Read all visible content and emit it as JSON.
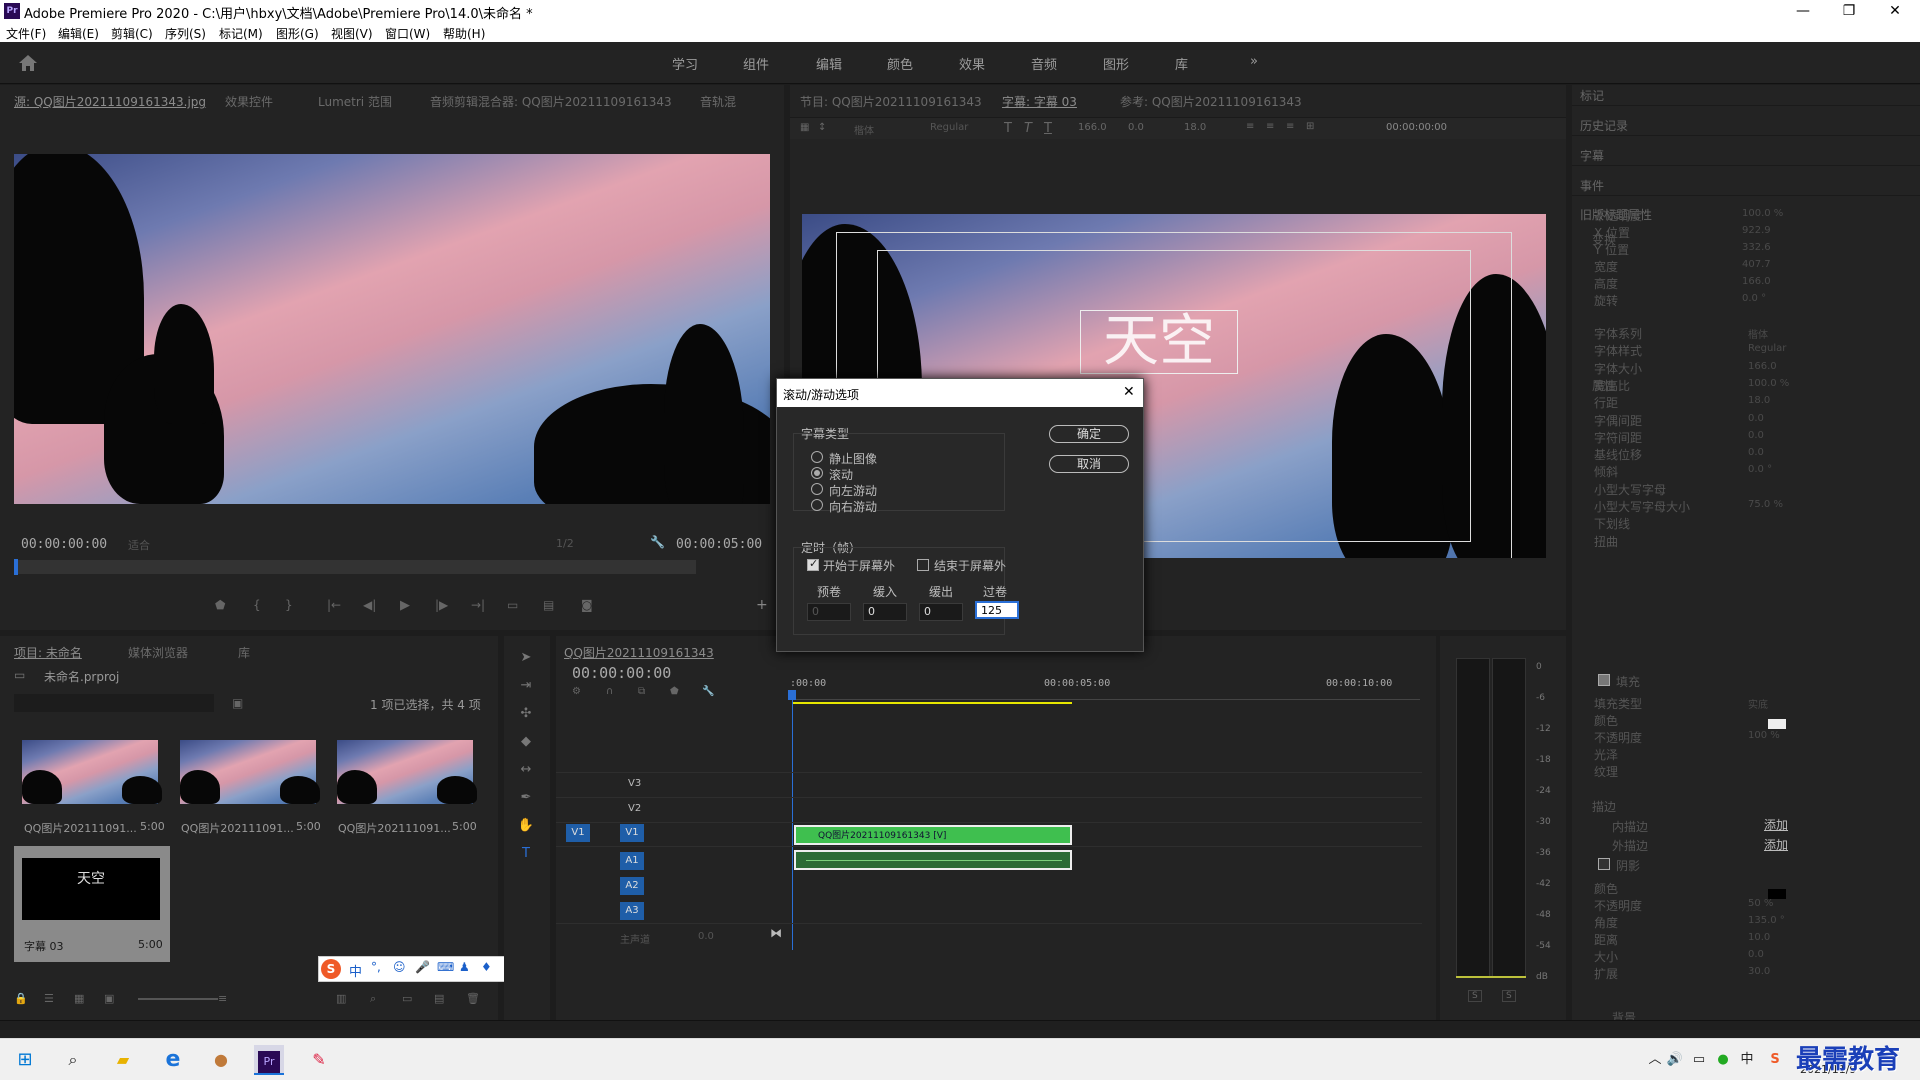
{
  "titlebar": {
    "icon": "Pr",
    "title": "Adobe Premiere Pro 2020 - C:\\用户\\hbxy\\文档\\Adobe\\Premiere Pro\\14.0\\未命名 *",
    "min": "—",
    "max": "❐",
    "close": "✕"
  },
  "menu": [
    "文件(F)",
    "编辑(E)",
    "剪辑(C)",
    "序列(S)",
    "标记(M)",
    "图形(G)",
    "视图(V)",
    "窗口(W)",
    "帮助(H)"
  ],
  "workspaces": [
    "学习",
    "组件",
    "编辑",
    "颜色",
    "效果",
    "音频",
    "图形",
    "库"
  ],
  "workspace_more": "»",
  "source_panel": {
    "tabs": [
      "源: QQ图片20211109161343.jpg",
      "效果控件",
      "Lumetri 范围",
      "音频剪辑混合器: QQ图片20211109161343",
      "音轨混"
    ],
    "timecode_left": "00:00:00:00",
    "fit": "适合",
    "half": "1/2",
    "timecode_right": "00:00:05:00"
  },
  "program_panel": {
    "tabs": [
      "节目: QQ图片20211109161343",
      "字幕: 字幕 03",
      "参考: QQ图片20211109161343"
    ],
    "font_family": "楷体",
    "font_style": "Regular",
    "size": "166.0",
    "kern": "0.0",
    "lead": "18.0",
    "timecode": "00:00:00:00",
    "title_text": "天空"
  },
  "right_panel": {
    "sections": [
      "标记",
      "历史记录",
      "字幕",
      "事件",
      "旧版标题属性"
    ],
    "transform_label": "变换",
    "props": [
      {
        "label": "不透明度",
        "value": "100.0 %"
      },
      {
        "label": "X 位置",
        "value": "922.9"
      },
      {
        "label": "Y 位置",
        "value": "332.6"
      },
      {
        "label": "宽度",
        "value": "407.7"
      },
      {
        "label": "高度",
        "value": "166.0"
      },
      {
        "label": "旋转",
        "value": "0.0 °"
      }
    ],
    "attr_label": "属性",
    "attrs": [
      {
        "label": "字体系列",
        "value": "楷体"
      },
      {
        "label": "字体样式",
        "value": "Regular"
      },
      {
        "label": "字体大小",
        "value": "166.0"
      },
      {
        "label": "宽高比",
        "value": "100.0 %"
      },
      {
        "label": "行距",
        "value": "18.0"
      },
      {
        "label": "字偶间距",
        "value": "0.0"
      },
      {
        "label": "字符间距",
        "value": "0.0"
      },
      {
        "label": "基线位移",
        "value": "0.0"
      },
      {
        "label": "倾斜",
        "value": "0.0 °"
      },
      {
        "label": "小型大写字母",
        "value": ""
      },
      {
        "label": "小型大写字母大小",
        "value": "75.0 %"
      },
      {
        "label": "下划线",
        "value": ""
      },
      {
        "label": "扭曲",
        "value": ""
      }
    ],
    "fill_label": "填充",
    "fill": [
      {
        "label": "填充类型",
        "value": "实底"
      },
      {
        "label": "颜色",
        "value": ""
      },
      {
        "label": "不透明度",
        "value": "100 %"
      },
      {
        "label": "光泽",
        "value": ""
      },
      {
        "label": "纹理",
        "value": ""
      }
    ],
    "stroke_label": "描边",
    "inner_stroke": "内描边",
    "outer_stroke": "外描边",
    "add": "添加",
    "shadow_label": "阴影",
    "shadow": [
      {
        "label": "颜色",
        "value": ""
      },
      {
        "label": "不透明度",
        "value": "50 %"
      },
      {
        "label": "角度",
        "value": "135.0 °"
      },
      {
        "label": "距离",
        "value": "10.0"
      },
      {
        "label": "大小",
        "value": "0.0"
      },
      {
        "label": "扩展",
        "value": "30.0"
      }
    ],
    "bg_label": "背景"
  },
  "project_panel": {
    "tabs": [
      "项目: 未命名",
      "媒体浏览器",
      "库"
    ],
    "project_name": "未命名.prproj",
    "selection": "1 项已选择，共 4 项",
    "items": [
      {
        "name": "QQ图片202111091...",
        "dur": "5:00"
      },
      {
        "name": "QQ图片202111091...",
        "dur": "5:00"
      },
      {
        "name": "QQ图片202111091...",
        "dur": "5:00"
      },
      {
        "name": "字幕 03",
        "dur": "5:00",
        "thumb_text": "天空"
      }
    ]
  },
  "timeline": {
    "tab": "QQ图片20211109161343",
    "timecode": "00:00:00:00",
    "ruler": [
      ":00:00",
      "00:00:05:00",
      "00:00:10:00"
    ],
    "tracks_video": [
      "V3",
      "V2",
      "V1"
    ],
    "tracks_audio": [
      "A1",
      "A2",
      "A3"
    ],
    "source_v": "V1",
    "master": "主声道",
    "master_val": "0.0",
    "clip_label": "QQ图片20211109161343 [V]"
  },
  "meter": {
    "scale": [
      "0",
      "-6",
      "-12",
      "-18",
      "-24",
      "-30",
      "-36",
      "-42",
      "-48",
      "-54",
      "dB"
    ],
    "solo": [
      "S",
      "S"
    ]
  },
  "dialog": {
    "title": "滚动/游动选项",
    "group1": "字幕类型",
    "options": [
      "静止图像",
      "滚动",
      "向左游动",
      "向右游动"
    ],
    "selected": 1,
    "group2": "定时（帧）",
    "start_off": "开始于屏幕外",
    "end_off": "结束于屏幕外",
    "fields": [
      {
        "label": "预卷",
        "value": "0"
      },
      {
        "label": "缓入",
        "value": "0"
      },
      {
        "label": "缓出",
        "value": "0"
      },
      {
        "label": "过卷",
        "value": "125"
      }
    ],
    "ok": "确定",
    "cancel": "取消"
  },
  "ime": {
    "lang": "中"
  },
  "taskbar": {
    "date": "2021/11/9",
    "watermark": "最需教育"
  },
  "colors": {
    "accent": "#1f5ea8",
    "clip_green": "#3fbf4f",
    "playhead": "#2a6fd6",
    "work_area": "#e6e600"
  }
}
